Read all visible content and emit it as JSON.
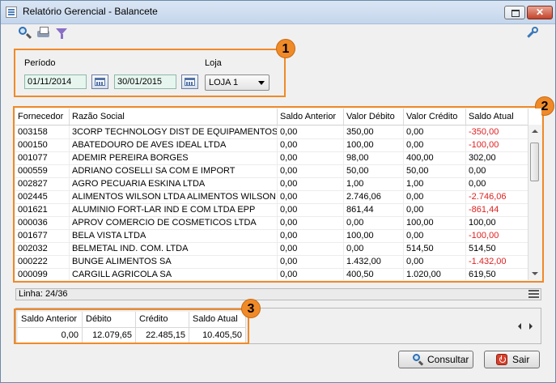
{
  "window": {
    "title": "Relatório Gerencial - Balancete",
    "icons": [
      "app-icon",
      "restore-icon",
      "close-icon"
    ]
  },
  "toolbar": {
    "icons": [
      "search-icon",
      "print-icon",
      "filter-icon",
      "key-icon"
    ]
  },
  "filters": {
    "periodo_label": "Período",
    "date_start": "01/11/2014",
    "date_end": "30/01/2015",
    "loja_label": "Loja",
    "loja_value": "LOJA 1",
    "badge": "1"
  },
  "grid": {
    "badge": "2",
    "columns": [
      "Fornecedor",
      "Razão Social",
      "Saldo Anterior",
      "Valor Débito",
      "Valor Crédito",
      "Saldo Atual"
    ],
    "rows": [
      [
        "003158",
        "3CORP TECHNOLOGY DIST DE EQUIPAMENTOS",
        "0,00",
        "350,00",
        "0,00",
        "-350,00"
      ],
      [
        "000150",
        "ABATEDOURO DE AVES IDEAL LTDA",
        "0,00",
        "100,00",
        "0,00",
        "-100,00"
      ],
      [
        "001077",
        "ADEMIR PEREIRA BORGES",
        "0,00",
        "98,00",
        "400,00",
        "302,00"
      ],
      [
        "000559",
        "ADRIANO COSELLI SA COM E IMPORT",
        "0,00",
        "50,00",
        "50,00",
        "0,00"
      ],
      [
        "002827",
        "AGRO PECUARIA ESKINA LTDA",
        "0,00",
        "1,00",
        "1,00",
        "0,00"
      ],
      [
        "002445",
        "ALIMENTOS WILSON LTDA ALIMENTOS WILSON L",
        "0,00",
        "2.746,06",
        "0,00",
        "-2.746,06"
      ],
      [
        "001621",
        "ALUMINIO FORT-LAR IND E COM LTDA EPP",
        "0,00",
        "861,44",
        "0,00",
        "-861,44"
      ],
      [
        "000036",
        "APROV COMERCIO DE COSMETICOS LTDA",
        "0,00",
        "0,00",
        "100,00",
        "100,00"
      ],
      [
        "001677",
        "BELA VISTA LTDA",
        "0,00",
        "100,00",
        "0,00",
        "-100,00"
      ],
      [
        "002032",
        "BELMETAL IND. COM. LTDA",
        "0,00",
        "0,00",
        "514,50",
        "514,50"
      ],
      [
        "000222",
        "BUNGE ALIMENTOS SA",
        "0,00",
        "1.432,00",
        "0,00",
        "-1.432,00"
      ],
      [
        "000099",
        "CARGILL AGRICOLA SA",
        "0,00",
        "400,50",
        "1.020,00",
        "619,50"
      ]
    ],
    "negative_color": "#e02020"
  },
  "status": {
    "linha": "Linha: 24/36"
  },
  "totals": {
    "badge": "3",
    "labels": [
      "Saldo Anterior",
      "Débito",
      "Crédito",
      "Saldo Atual"
    ],
    "values": [
      "0,00",
      "12.079,65",
      "22.485,15",
      "10.405,50"
    ]
  },
  "buttons": {
    "consultar": "Consultar",
    "sair": "Sair"
  },
  "colors": {
    "highlight": "#f08a28"
  }
}
